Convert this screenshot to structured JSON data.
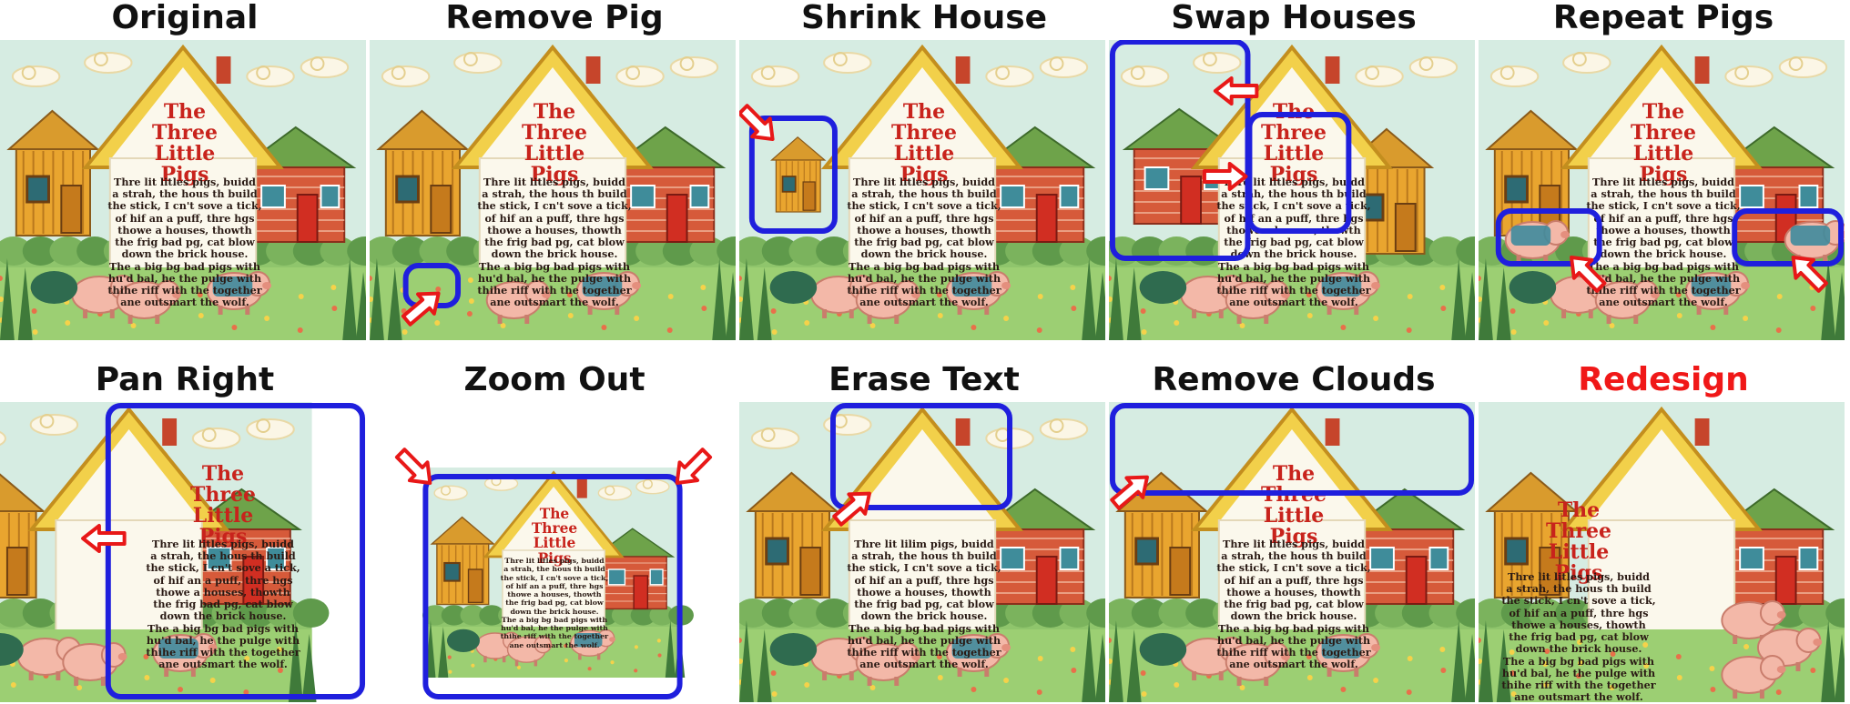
{
  "captions": [
    "Original",
    "Remove Pig",
    "Shrink House",
    "Swap Houses",
    "Repeat Pigs",
    "Pan Right",
    "Zoom Out",
    "Erase Text",
    "Remove Clouds",
    "Redesign"
  ],
  "caption_colors": {
    "default": "#111111",
    "highlight": "#f01818"
  },
  "colors": {
    "box": "#1f1fdd",
    "arrow": "#e81818",
    "sky": "#cfe8df",
    "grass": "#8ec56a"
  },
  "illustration": {
    "title_lines": [
      "The",
      "Three",
      "Little Pigs"
    ],
    "poem_lines": [
      "Thre lit litles pigs, buidd",
      "a strah, the hous th build",
      "the stick, I cn't sove a tick,",
      "of hif an a puff, thre hgs",
      "thowe a houses, thowth",
      "the frig bad pg, cat blow",
      "down the brick house.",
      "The a big bg bad pigs with",
      "hu'd bal, he the pulge with",
      "thihe riff with the together",
      "ane outsmart the wolf."
    ],
    "erased_poem_lines": [
      "Thre lit lilim pigs, buidd"
    ]
  }
}
